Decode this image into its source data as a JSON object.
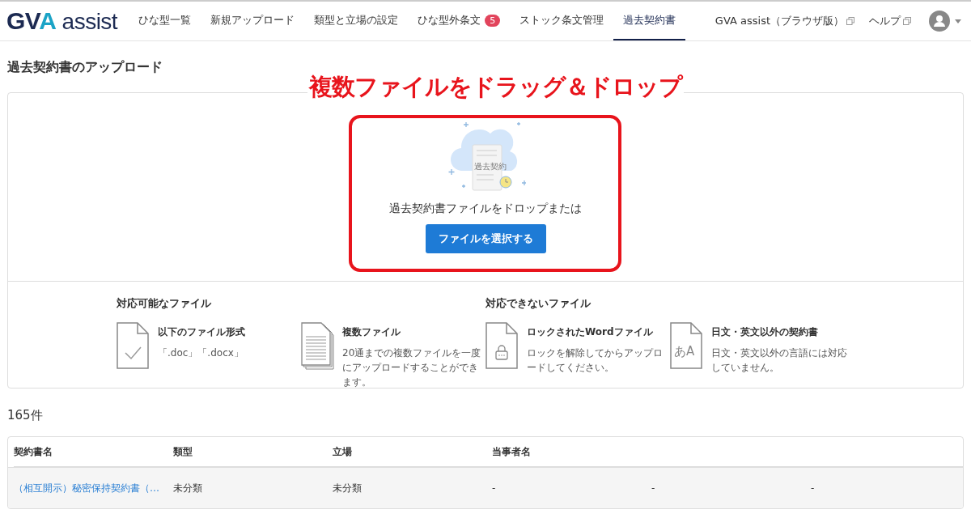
{
  "header": {
    "logo": "GVA assist",
    "nav": [
      {
        "label": "ひな型一覧",
        "selected": false
      },
      {
        "label": "新規アップロード",
        "selected": false
      },
      {
        "label": "類型と立場の設定",
        "selected": false
      },
      {
        "label": "ひな型外条文",
        "selected": false,
        "badge": "5"
      },
      {
        "label": "ストック条文管理",
        "selected": false
      },
      {
        "label": "過去契約書",
        "selected": true
      }
    ],
    "links": [
      "GVA assist（ブラウザ版）",
      "ヘルプ"
    ]
  },
  "page_title": "過去契約書のアップロード",
  "annotation": "複数ファイルをドラッグ＆ドロップ",
  "upload": {
    "illustration_label": "過去契約",
    "prompt": "過去契約書ファイルをドロップまたは",
    "button": "ファイルを選択する"
  },
  "file_groups": [
    {
      "heading": "対応可能なファイル",
      "items": [
        {
          "kind": "check",
          "title": "以下のファイル形式",
          "text": "「.doc」「.docx」"
        },
        {
          "kind": "stack",
          "title": "複数ファイル",
          "text": "20通までの複数ファイルを一度にアップロードすることができます。"
        }
      ]
    },
    {
      "heading": "対応できないファイル",
      "items": [
        {
          "kind": "lock",
          "title": "ロックされたWordファイル",
          "text": "ロックを解除してからアップロードしてください。"
        },
        {
          "kind": "lang",
          "title": "日文・英文以外の契約書",
          "text": "日文・英文以外の言語には対応していません。",
          "icon_text": "あA"
        }
      ]
    }
  ],
  "count": "165件",
  "table": {
    "columns": [
      "契約書名",
      "類型",
      "立場",
      "当事者名"
    ],
    "rows": [
      {
        "cells": [
          "（相互開示）秘密保持契約書（…",
          "未分類",
          "未分類",
          "-",
          "-",
          "-"
        ]
      }
    ]
  }
}
